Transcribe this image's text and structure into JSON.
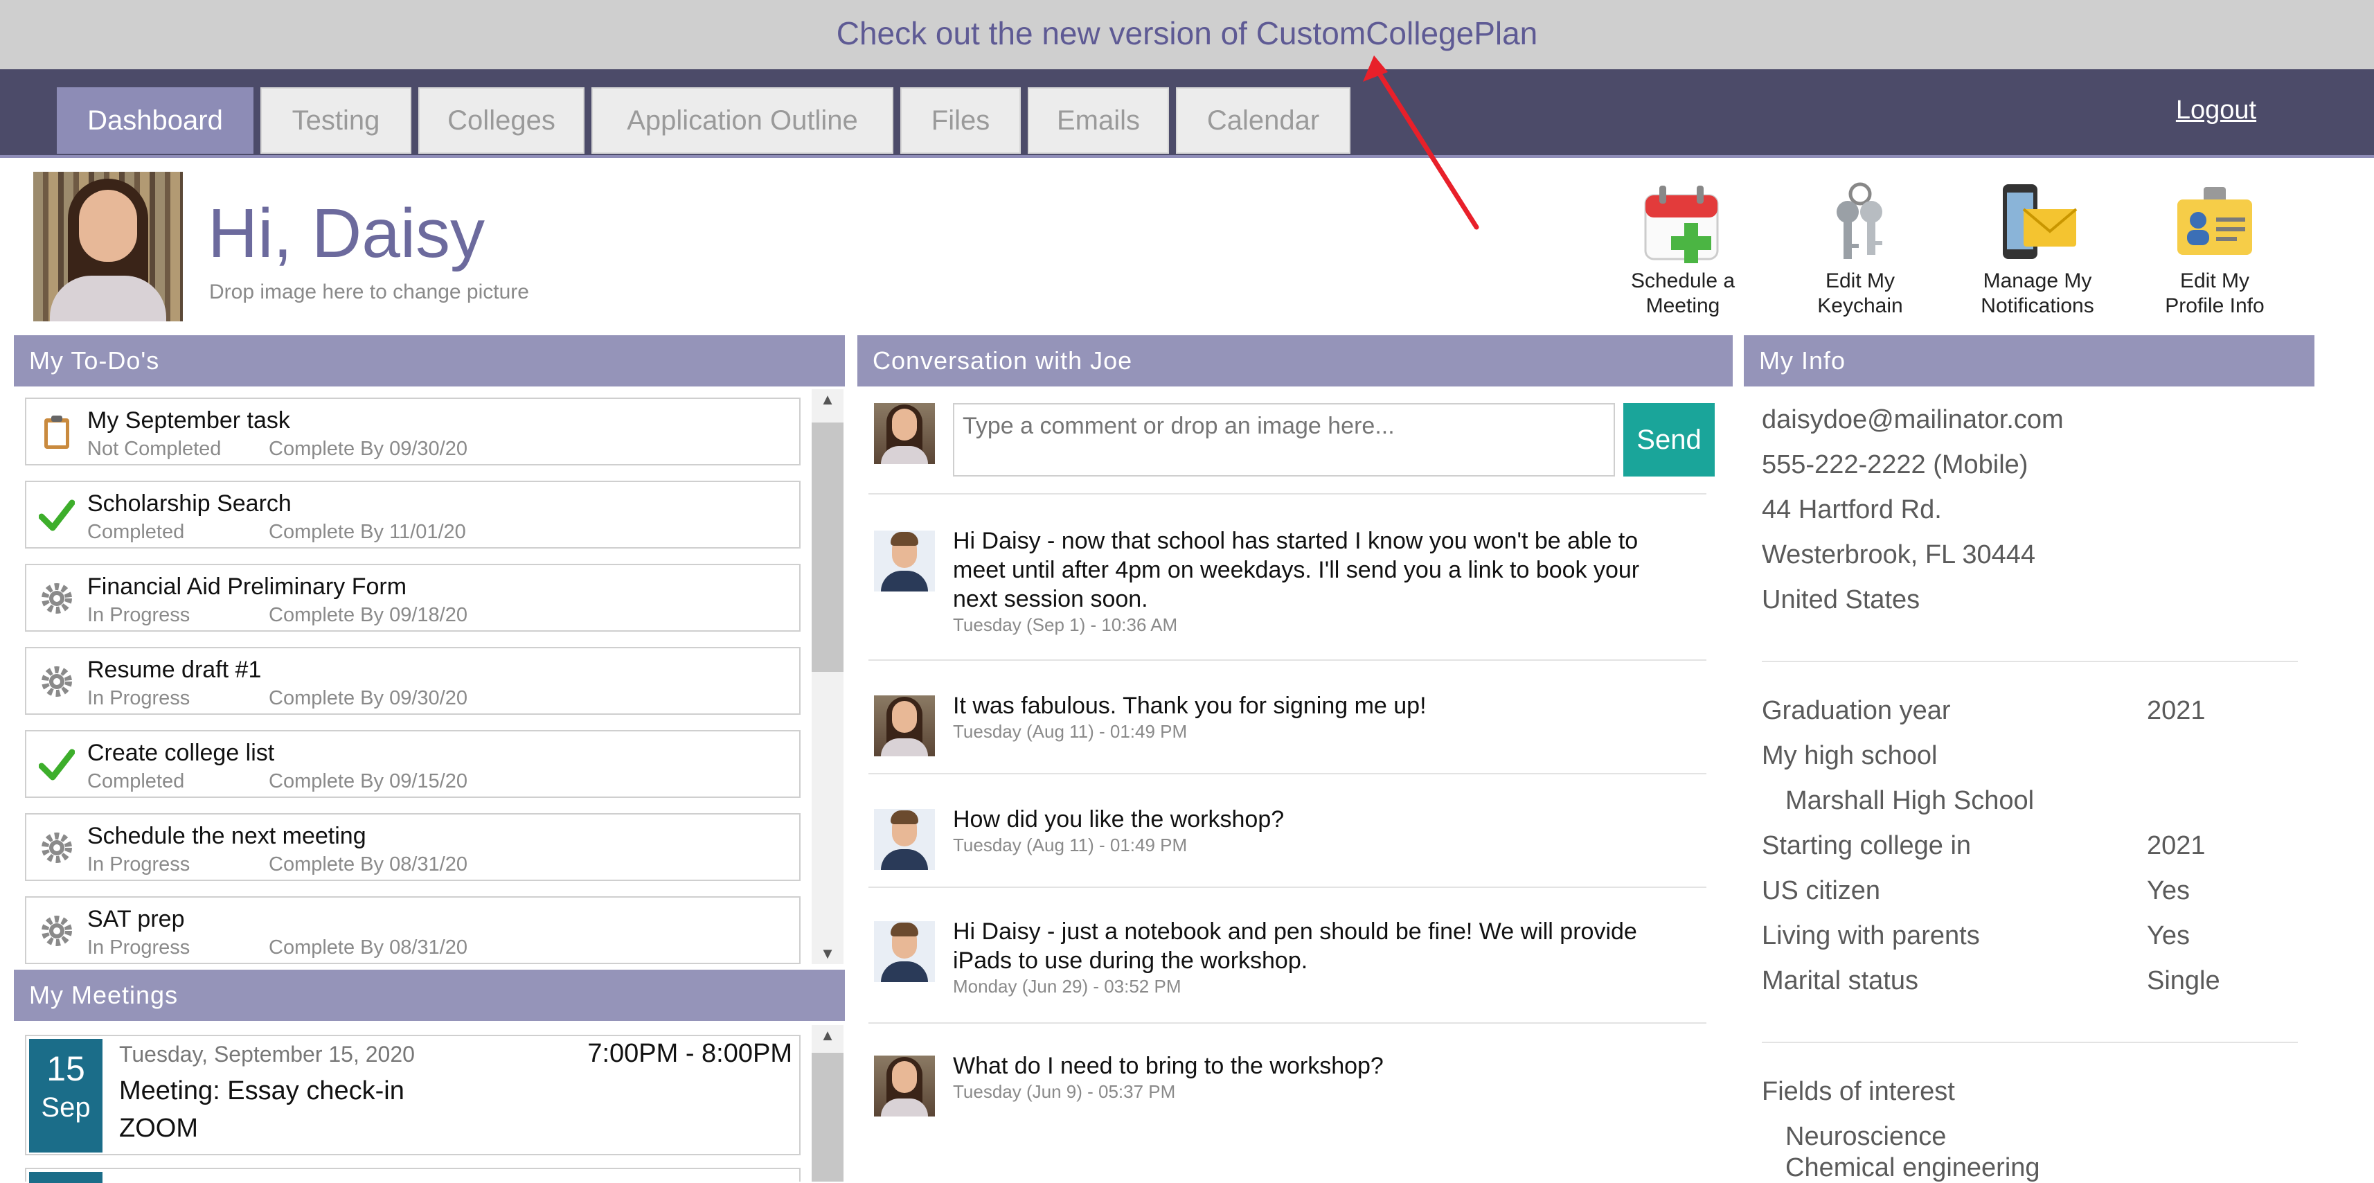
{
  "banner": {
    "text": "Check out the new version of CustomCollegePlan"
  },
  "nav": {
    "tabs": [
      {
        "label": "Dashboard",
        "active": true
      },
      {
        "label": "Testing"
      },
      {
        "label": "Colleges"
      },
      {
        "label": "Application Outline"
      },
      {
        "label": "Files"
      },
      {
        "label": "Emails"
      },
      {
        "label": "Calendar"
      }
    ],
    "logout": "Logout"
  },
  "profile": {
    "greeting": "Hi, Daisy",
    "drop_hint": "Drop image here to change picture"
  },
  "actions": [
    {
      "line1": "Schedule a",
      "line2": "Meeting",
      "icon": "calendar-add-icon"
    },
    {
      "line1": "Edit My",
      "line2": "Keychain",
      "icon": "keys-icon"
    },
    {
      "line1": "Manage My",
      "line2": "Notifications",
      "icon": "phone-mail-icon"
    },
    {
      "line1": "Edit My",
      "line2": "Profile Info",
      "icon": "id-card-icon"
    }
  ],
  "todos": {
    "title": "My To-Do's",
    "items": [
      {
        "title": "My September task",
        "status": "Not Completed",
        "due": "Complete By 09/30/20",
        "icon": "clipboard-icon"
      },
      {
        "title": "Scholarship Search",
        "status": "Completed",
        "due": "Complete By 11/01/20",
        "icon": "checkmark-icon"
      },
      {
        "title": "Financial Aid Preliminary Form",
        "status": "In Progress",
        "due": "Complete By 09/18/20",
        "icon": "gear-icon"
      },
      {
        "title": "Resume draft #1",
        "status": "In Progress",
        "due": "Complete By 09/30/20",
        "icon": "gear-icon"
      },
      {
        "title": "Create college list",
        "status": "Completed",
        "due": "Complete By 09/15/20",
        "icon": "checkmark-icon"
      },
      {
        "title": "Schedule the next meeting",
        "status": "In Progress",
        "due": "Complete By 08/31/20",
        "icon": "gear-icon"
      },
      {
        "title": "SAT prep",
        "status": "In Progress",
        "due": "Complete By 08/31/20",
        "icon": "gear-icon"
      }
    ]
  },
  "meetings": {
    "title": "My Meetings",
    "items": [
      {
        "day": "15",
        "month": "Sep",
        "date": "Tuesday, September 15, 2020",
        "time": "7:00PM - 8:00PM",
        "title": "Meeting: Essay check-in",
        "location": "ZOOM"
      }
    ]
  },
  "conversation": {
    "title": "Conversation with Joe",
    "placeholder": "Type a comment or drop an image here...",
    "send": "Send",
    "messages": [
      {
        "from": "joe",
        "text": "Hi Daisy - now that school has started I know you won't be able to meet until after 4pm on weekdays. I'll send you a link to book your next session soon.",
        "time": "Tuesday (Sep 1) - 10:36 AM"
      },
      {
        "from": "daisy",
        "text": "It was fabulous. Thank you for signing me up!",
        "time": "Tuesday (Aug 11) - 01:49 PM"
      },
      {
        "from": "joe",
        "text": "How did you like the workshop?",
        "time": "Tuesday (Aug 11) - 01:49 PM"
      },
      {
        "from": "joe",
        "text": "Hi Daisy - just a notebook and pen should be fine! We will provide iPads to use during the workshop.",
        "time": "Monday (Jun 29) - 03:52 PM"
      },
      {
        "from": "daisy",
        "text": "What do I need to bring to the workshop?",
        "time": "Tuesday (Jun 9) - 05:37 PM"
      }
    ]
  },
  "info": {
    "title": "My Info",
    "email": "daisydoe@mailinator.com",
    "phone": "555-222-2222 (Mobile)",
    "address1": "44 Hartford Rd.",
    "address2": "Westerbrook, FL 30444",
    "country": "United States",
    "graduation_label": "Graduation year",
    "graduation_value": "2021",
    "high_school_label": "My high school",
    "high_school_value": "Marshall High School",
    "starting_label": "Starting college in",
    "starting_value": "2021",
    "citizen_label": "US citizen",
    "citizen_value": "Yes",
    "parents_label": "Living with parents",
    "parents_value": "Yes",
    "marital_label": "Marital status",
    "marital_value": "Single",
    "fields_label": "Fields of interest",
    "fields": [
      "Neuroscience",
      "Chemical engineering"
    ]
  },
  "colors": {
    "accent": "#9594b9",
    "nav": "#4c4b69",
    "send": "#1aa59a",
    "meeting": "#1b6d89",
    "arrow": "#e8202a"
  }
}
